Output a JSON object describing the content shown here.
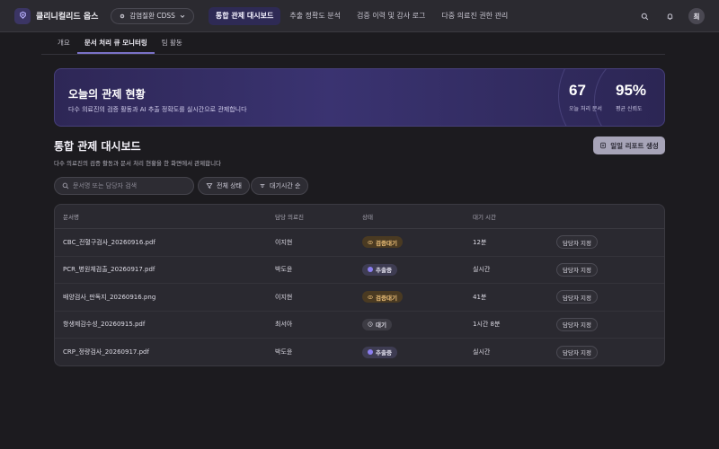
{
  "app": {
    "name": "클리니컬리드 옵스",
    "context": "감염질환 CDSS"
  },
  "nav": [
    "통합 관제 대시보드",
    "추출 정확도 분석",
    "검증 이력 및 감사 로그",
    "다중 의료진 권한 관리"
  ],
  "user": {
    "avatar": "최"
  },
  "subtabs": [
    "개요",
    "문서 처리 큐 모니터링",
    "팀 활동"
  ],
  "hero": {
    "title": "오늘의 관제 현황",
    "subtitle": "다수 의료진의 검증 활동과 AI 추출 정확도를 실시간으로 관제합니다",
    "stats": [
      {
        "value": "67",
        "label": "오늘 처리 문서"
      },
      {
        "value": "95%",
        "label": "평균 신뢰도"
      }
    ]
  },
  "page": {
    "title": "통합 관제 대시보드",
    "subtitle": "다수 의료진의 검증 활동과 문서 처리 현황을 한 화면에서 관제합니다",
    "report_button": "일일 리포트 생성"
  },
  "filters": {
    "search_placeholder": "문서명 또는 담당자 검색",
    "status": "전체 상태",
    "sort": "대기시간 순"
  },
  "table": {
    "headers": [
      "문서명",
      "담당 의료진",
      "상태",
      "대기 시간"
    ],
    "rows": [
      {
        "doc": "CBC_전혈구검사_20260916.pdf",
        "owner": "이지현",
        "status": "검증대기",
        "wait": "12분",
        "action": "담당자 지정"
      },
      {
        "doc": "PCR_병원체검출_20260917.pdf",
        "owner": "박도윤",
        "status": "추출중",
        "wait": "실시간",
        "action": "담당자 지정"
      },
      {
        "doc": "배양검사_판독지_20260916.png",
        "owner": "이지현",
        "status": "검증대기",
        "wait": "41분",
        "action": "담당자 지정"
      },
      {
        "doc": "항생제감수성_20260915.pdf",
        "owner": "최서아",
        "status": "대기",
        "wait": "1시간 8분",
        "action": "담당자 지정"
      },
      {
        "doc": "CRP_정량검사_20260917.pdf",
        "owner": "박도윤",
        "status": "추출중",
        "wait": "실시간",
        "action": "담당자 지정"
      }
    ]
  },
  "colors": {
    "accent": "#2e2a55",
    "status_review": "#4a3a22",
    "status_review_text": "#f0c27a",
    "status_extract": "#3e3c52",
    "status_extract_dot": "#8b7ef0",
    "status_wait": "#3d3c44"
  }
}
